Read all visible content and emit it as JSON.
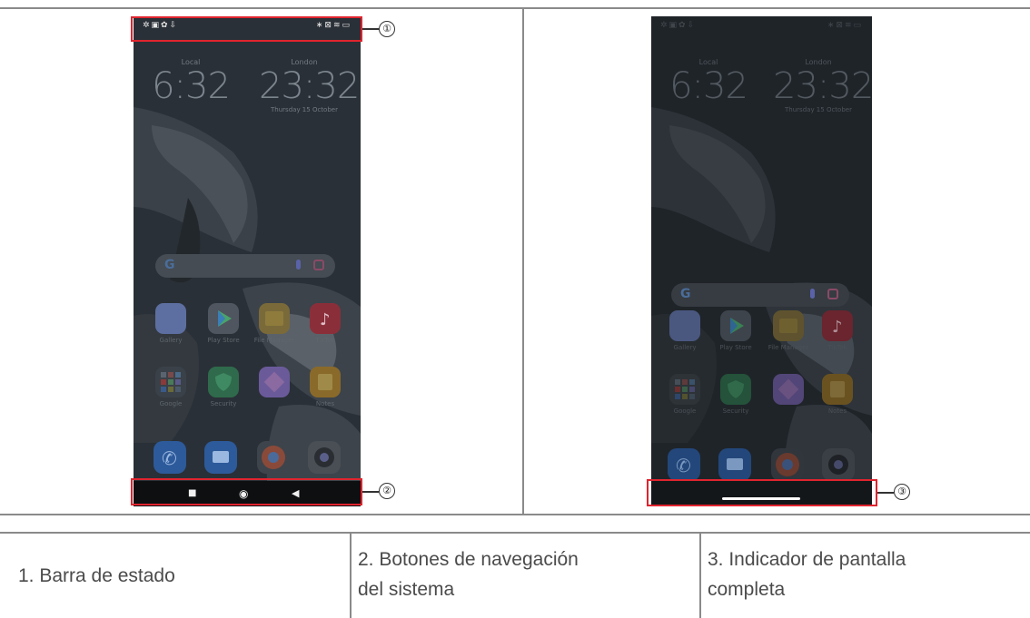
{
  "callouts": {
    "c1": "①",
    "c2": "②",
    "c3": "③"
  },
  "phone": {
    "status_left_icons": "✲▣✿⇩",
    "status_right_icons": "∗⊠≋▭",
    "clock_local_label": "Local",
    "clock_local_time": "6:32",
    "clock_remote_label": "London",
    "clock_remote_time": "23:32",
    "clock_date": "Thursday 15 October",
    "search_logo": "G",
    "apps_row1": [
      "Gallery",
      "Play Store",
      "File Manager",
      "TikTok"
    ],
    "apps_row2": [
      "Google",
      "Security",
      "",
      "Notes"
    ],
    "nav_square": "■",
    "nav_circle": "◉",
    "nav_back": "◀"
  },
  "legend": {
    "item1": "1. Barra de estado",
    "item2_line1": "2. Botones de navegación",
    "item2_line2": "del sistema",
    "item3_line1": "3. Indicador de pantalla",
    "item3_line2": "completa"
  },
  "colors": {
    "callout_red": "#e0242e",
    "rule_grey": "#8a8a8a"
  }
}
